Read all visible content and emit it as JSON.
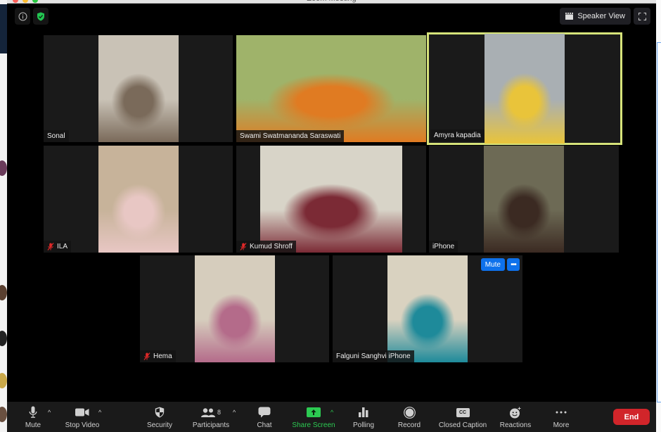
{
  "window": {
    "title": "Zoom Meeting"
  },
  "top_bar": {
    "info_icon": "info-icon",
    "security_icon": "shield-check-icon",
    "speaker_view_label": "Speaker View",
    "fullscreen_icon": "fullscreen-icon"
  },
  "participants": [
    {
      "name": "Sonal",
      "muted": false,
      "active_speaker": false,
      "colors": {
        "bg": "#c9c2b6",
        "accent": "#7a6a5a"
      }
    },
    {
      "name": "Swami Swatmananda Saraswati",
      "muted": false,
      "active_speaker": false,
      "colors": {
        "bg": "#9fb36a",
        "accent": "#e07b22"
      }
    },
    {
      "name": "Amyra kapadia",
      "muted": false,
      "active_speaker": true,
      "colors": {
        "bg": "#a9afb3",
        "accent": "#e9c43a"
      }
    },
    {
      "name": "ILA",
      "muted": true,
      "active_speaker": false,
      "colors": {
        "bg": "#c7b39a",
        "accent": "#e8c7c4"
      }
    },
    {
      "name": "Kumud Shroff",
      "muted": true,
      "active_speaker": false,
      "colors": {
        "bg": "#d8d4c8",
        "accent": "#7b2a35"
      }
    },
    {
      "name": "iPhone",
      "muted": false,
      "active_speaker": false,
      "colors": {
        "bg": "#6d6a55",
        "accent": "#3b2a22"
      }
    },
    {
      "name": "Hema",
      "muted": true,
      "active_speaker": false,
      "colors": {
        "bg": "#d6cdbd",
        "accent": "#b46b8a"
      }
    },
    {
      "name": "Falguni Sanghvi iPhone",
      "muted": false,
      "active_speaker": false,
      "colors": {
        "bg": "#d9d2c0",
        "accent": "#1e8a9a"
      }
    }
  ],
  "hover_controls": {
    "mute_label": "Mute",
    "more_label": "•••"
  },
  "toolbar": {
    "mute_label": "Mute",
    "stop_video_label": "Stop Video",
    "security_label": "Security",
    "participants_label": "Participants",
    "participants_count": "8",
    "chat_label": "Chat",
    "share_screen_label": "Share Screen",
    "polling_label": "Polling",
    "record_label": "Record",
    "closed_caption_label": "Closed Caption",
    "cc_glyph": "CC",
    "reactions_label": "Reactions",
    "more_label": "More",
    "end_label": "End",
    "caret": "^"
  },
  "colors": {
    "active_speaker_border": "#d6e37a",
    "share_green": "#2ccb52",
    "end_red": "#d1252a",
    "mute_blue": "#0e71eb",
    "muted_red": "#e02828"
  }
}
